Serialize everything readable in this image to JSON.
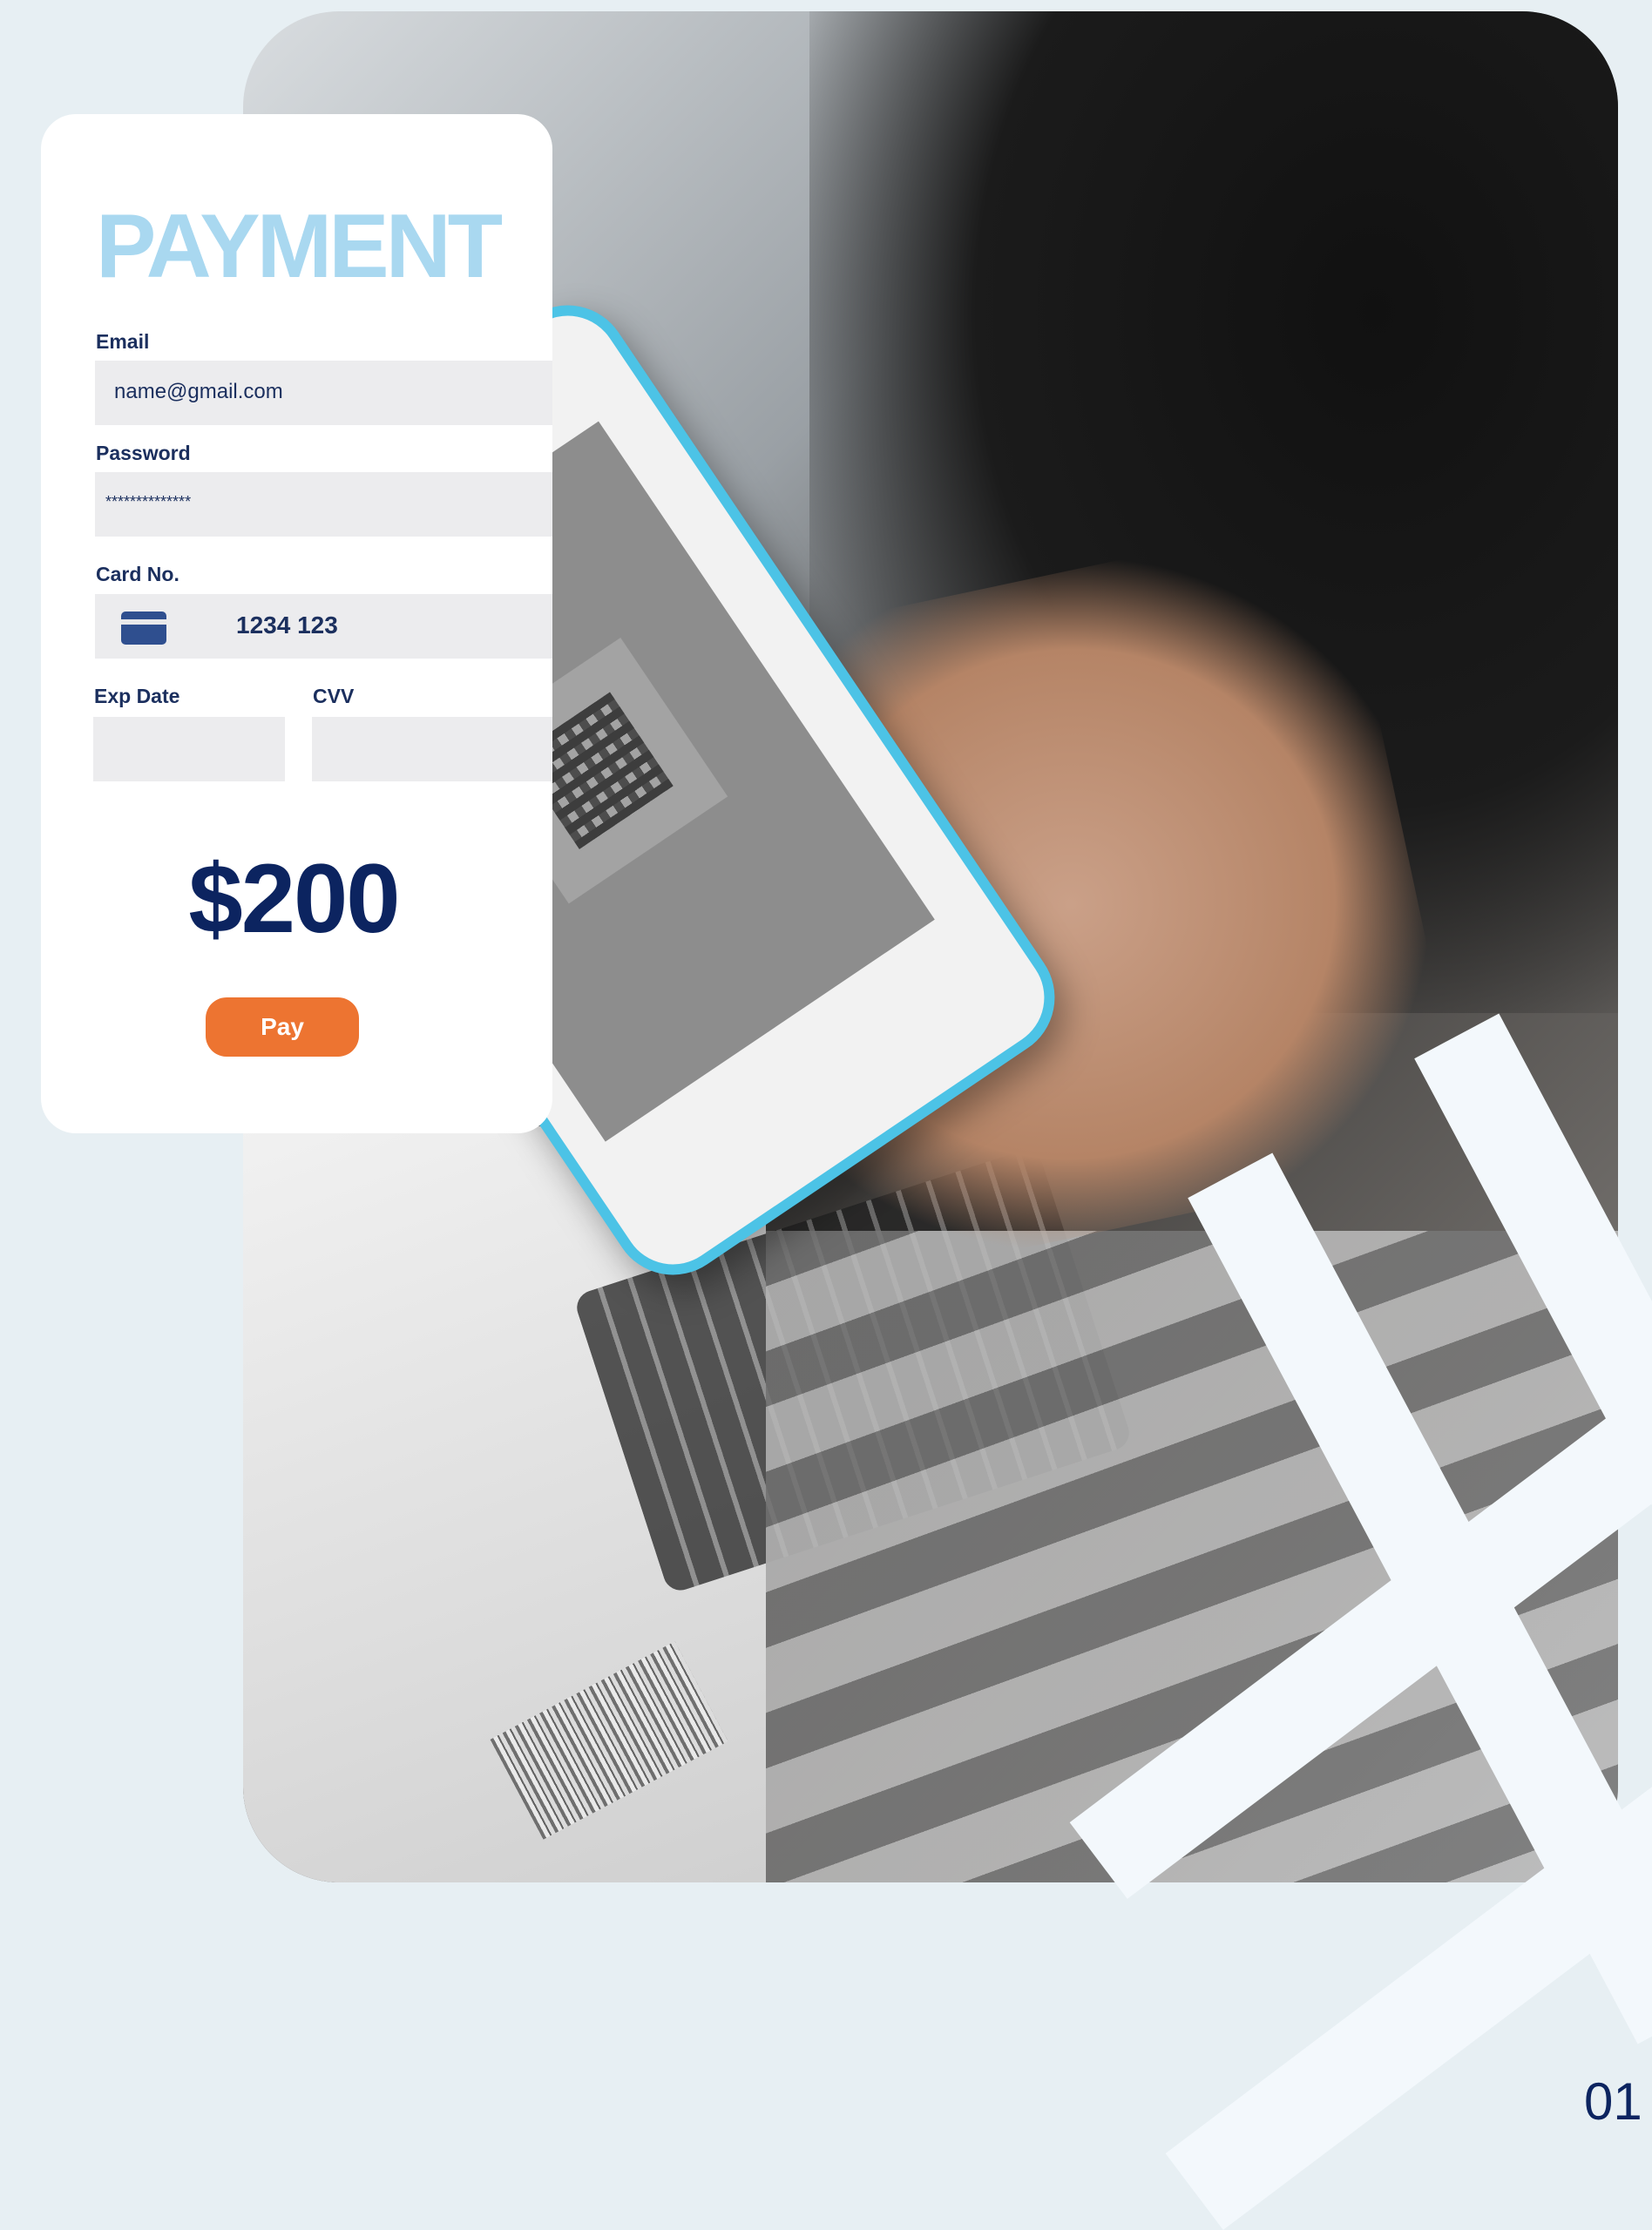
{
  "payment_card": {
    "title": "PAYMENT",
    "email_label": "Email",
    "email_value": "name@gmail.com",
    "password_label": "Password",
    "password_value": "**************",
    "card_label": "Card No.",
    "card_value": "1234 123",
    "exp_label": "Exp Date",
    "cvv_label": "CVV",
    "amount": "$200",
    "pay_label": "Pay"
  },
  "page_number": "01",
  "colors": {
    "background": "#e7eff3",
    "title": "#a9d8f0",
    "navy": "#0c2460",
    "pay_button": "#ed7431",
    "phone_case": "#4cc3e6"
  }
}
